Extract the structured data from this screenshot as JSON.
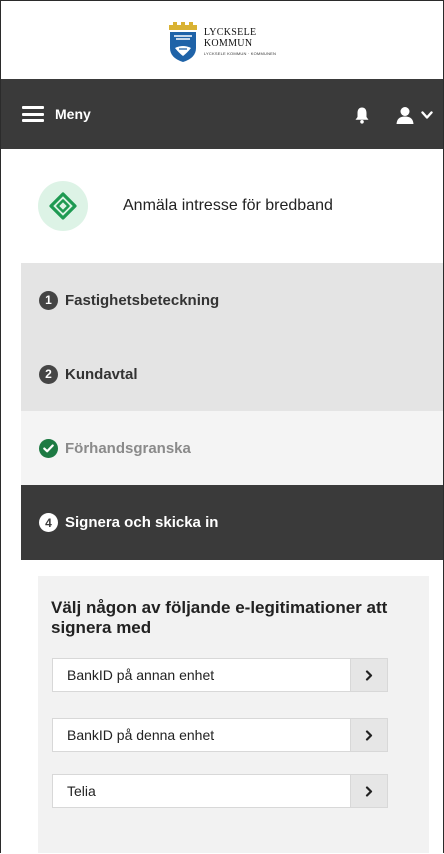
{
  "logo": {
    "line1": "LYCKSELE",
    "line2": "KOMMUN",
    "line3": "LYCKSELE KOMMUN · KOMMUNEN",
    "crest_colors": {
      "gold": "#d9b233",
      "blue": "#1f63a8"
    }
  },
  "header": {
    "menu_label": "Meny",
    "icons": [
      "hamburger-icon",
      "bell-icon",
      "user-icon",
      "chevron-down-icon"
    ],
    "background": "#3a3a3a"
  },
  "service": {
    "title": "Anmäla intresse för bredband",
    "icon": "diamond-icon",
    "icon_color": "#1e9a52",
    "icon_bg": "#ddf3e6"
  },
  "steps": [
    {
      "number": "1",
      "label": "Fastighetsbeteckning",
      "state": "done-inactive"
    },
    {
      "number": "2",
      "label": "Kundavtal",
      "state": "done-inactive"
    },
    {
      "number": "",
      "label": "Förhandsgranska",
      "state": "completed"
    },
    {
      "number": "4",
      "label": "Signera och skicka in",
      "state": "active"
    }
  ],
  "sign": {
    "heading": "Välj någon av följande e-legitimationer att signera med",
    "options": [
      {
        "label": "BankID på annan enhet"
      },
      {
        "label": "BankID på denna enhet"
      },
      {
        "label": "Telia"
      }
    ]
  }
}
